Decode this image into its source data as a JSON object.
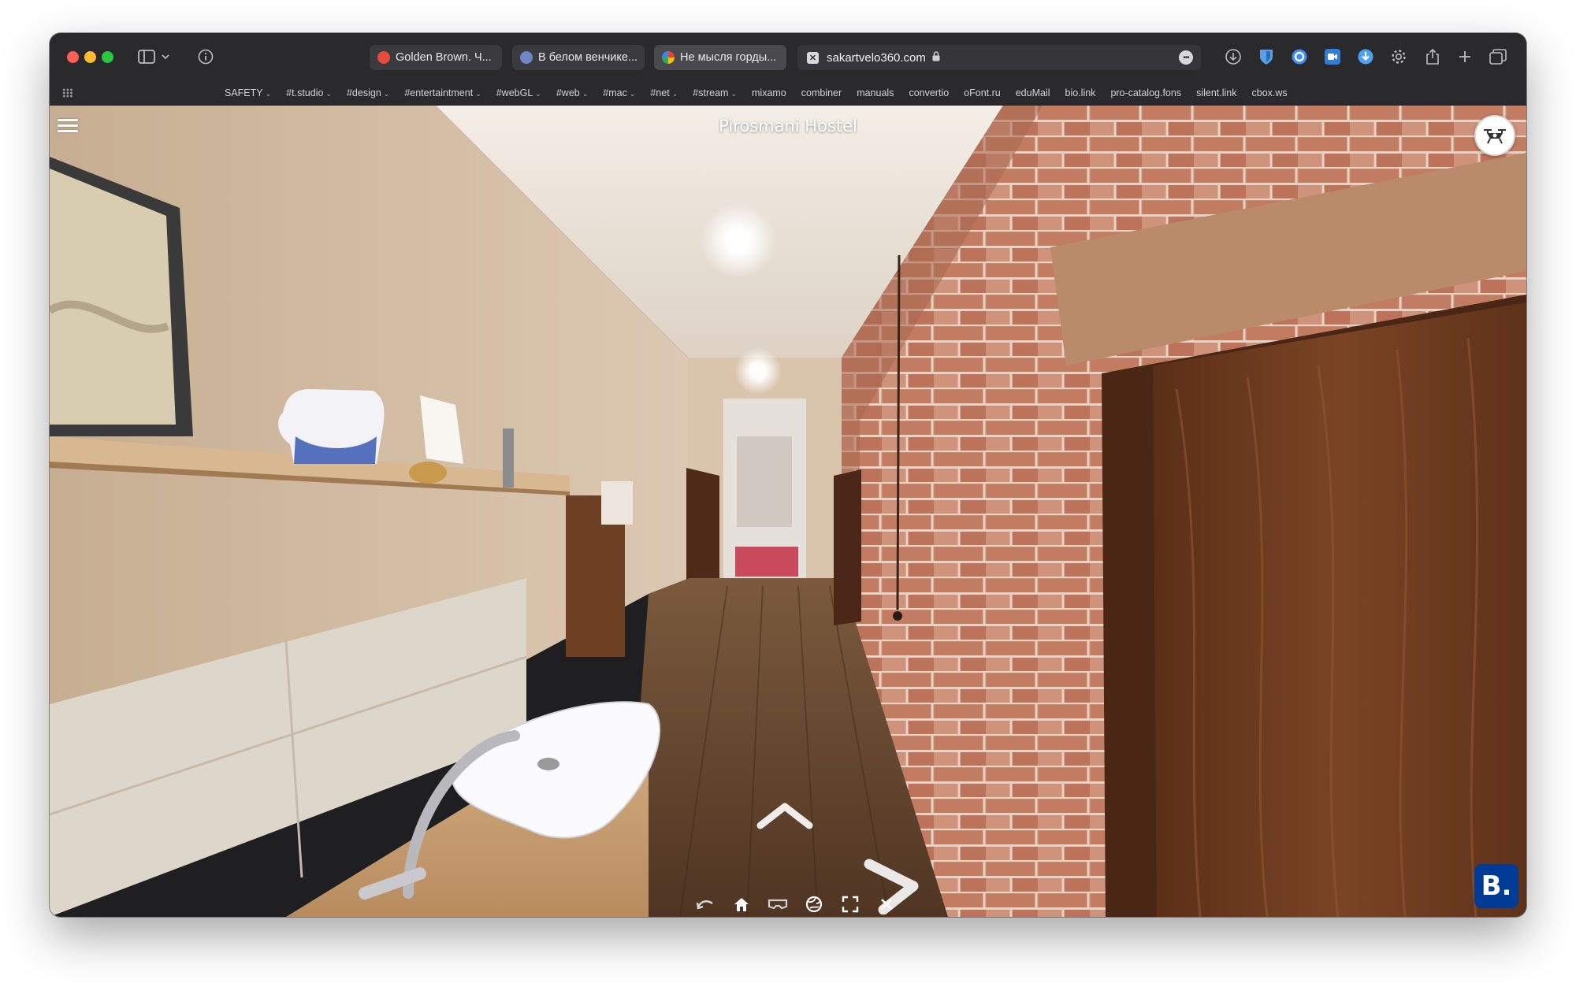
{
  "browser": {
    "tabs": [
      {
        "label": "Golden Brown. Ч...",
        "favicon_color": "#e84b3c"
      },
      {
        "label": "В белом венчике...",
        "favicon_color": "#6f86c9"
      },
      {
        "label": "Не мысля горды...",
        "favicon_color": "#4285f4"
      }
    ],
    "address": "sakartvelo360.com",
    "bookmarks": [
      {
        "label": "SAFETY",
        "folder": true
      },
      {
        "label": "#t.studio",
        "folder": true
      },
      {
        "label": "#design",
        "folder": true
      },
      {
        "label": "#entertaintment",
        "folder": true
      },
      {
        "label": "#webGL",
        "folder": true
      },
      {
        "label": "#web",
        "folder": true
      },
      {
        "label": "#mac",
        "folder": true
      },
      {
        "label": "#net",
        "folder": true
      },
      {
        "label": "#stream",
        "folder": true
      },
      {
        "label": "mixamo",
        "folder": false
      },
      {
        "label": "combiner",
        "folder": false
      },
      {
        "label": "manuals",
        "folder": false
      },
      {
        "label": "convertio",
        "folder": false
      },
      {
        "label": "oFont.ru",
        "folder": false
      },
      {
        "label": "eduMail",
        "folder": false
      },
      {
        "label": "bio.link",
        "folder": false
      },
      {
        "label": "pro-catalog.fons",
        "folder": false
      },
      {
        "label": "silent.link",
        "folder": false
      },
      {
        "label": "cbox.ws",
        "folder": false
      }
    ]
  },
  "tour": {
    "title": "Pirosmani Hostel",
    "booking_label": "B.",
    "controls": [
      "back-icon",
      "home-icon",
      "vr-icon",
      "globe-icon",
      "fullscreen-icon",
      "close-icon"
    ]
  },
  "colors": {
    "accent_booking": "#003b95",
    "wall_beige": "#cbb6a0",
    "brick": "#b46f58",
    "door_brown": "#6b3a1e",
    "floor_wood": "#6b4a30"
  }
}
